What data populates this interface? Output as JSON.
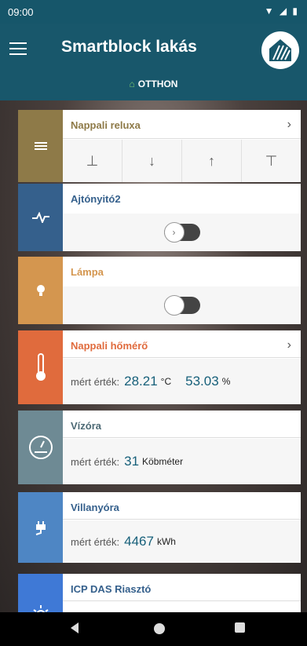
{
  "status": {
    "time": "09:00",
    "icons": "▼ ◢ ▮"
  },
  "app": {
    "title": "Smartblock lakás",
    "location": "OTTHON"
  },
  "devices": [
    {
      "name": "Nappali reluxa",
      "color": "#8e7a48",
      "name_color": "#8e7a48",
      "icon": "blinds-icon"
    },
    {
      "name": "Ajtónyitó2",
      "color": "#35608c",
      "name_color": "#35608c",
      "icon": "pulse-icon",
      "toggle": "off-arrow"
    },
    {
      "name": "Lámpa",
      "color": "#d4964f",
      "name_color": "#d4964f",
      "icon": "bulb-icon",
      "toggle": "off"
    },
    {
      "name": "Nappali hőmérő",
      "color": "#e06b3d",
      "name_color": "#e06b3d",
      "icon": "thermometer-icon",
      "label": "mért érték:",
      "value1": "28.21",
      "unit1": "°C",
      "value2": "53.03",
      "unit2": "%"
    },
    {
      "name": "Vízóra",
      "color": "#6e8a94",
      "name_color": "#4d6a75",
      "icon": "gauge-icon",
      "label": "mért érték:",
      "value1": "31",
      "unit1": "Köbméter"
    },
    {
      "name": "Villanyóra",
      "color": "#4e86c4",
      "name_color": "#35608c",
      "icon": "plug-icon",
      "label": "mért érték:",
      "value1": "4467",
      "unit1": "kWh"
    },
    {
      "name": "ICP DAS Riasztó",
      "color": "#3f79d6",
      "name_color": "#35608c",
      "icon": "alarm-icon"
    }
  ],
  "blind_buttons": [
    "⊥",
    "↓",
    "↑",
    "⊤"
  ]
}
